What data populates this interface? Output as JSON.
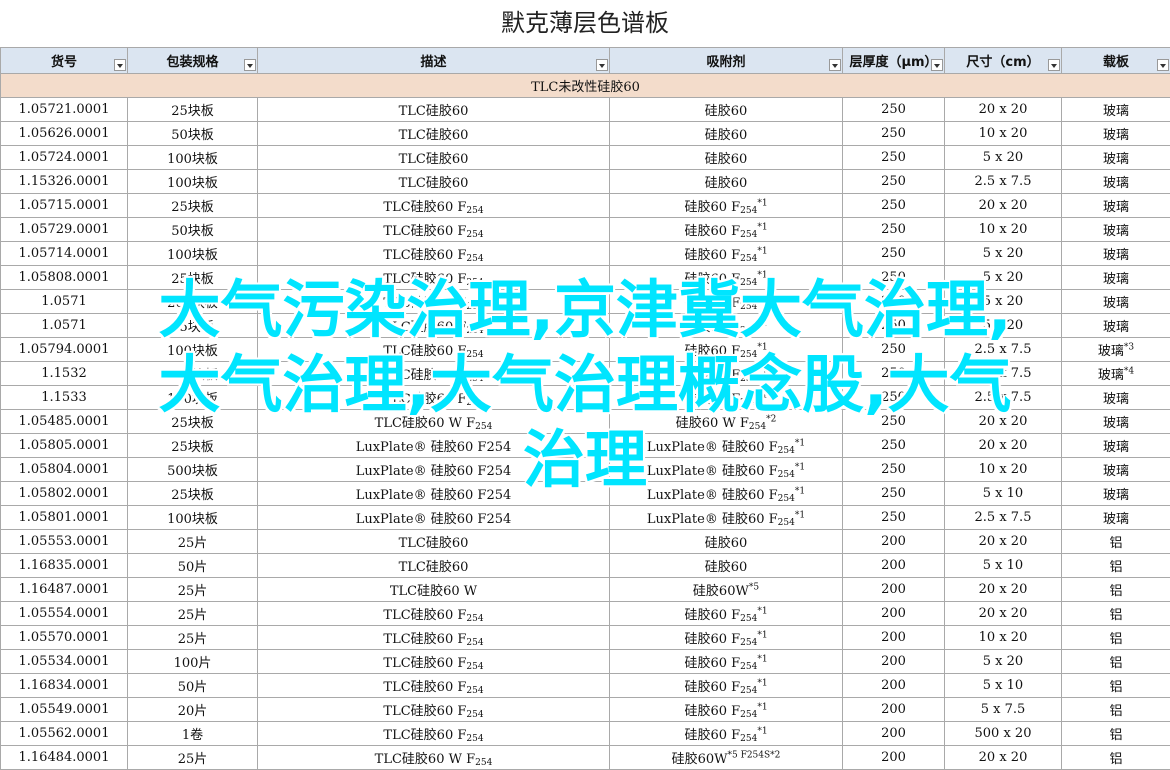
{
  "title": "默克薄层色谱板",
  "headers": [
    "货号",
    "包装规格",
    "描述",
    "吸附剂",
    "层厚度（μm）",
    "尺寸（cm）",
    "载板"
  ],
  "group_label": "TLC未改性硅胶60",
  "rows": [
    {
      "id": "1.05721.0001",
      "pack": "25块板",
      "desc": "TLC硅胶60",
      "desc_sub": "",
      "adsorb": "硅胶60",
      "adsorb_sub": "",
      "adsorb_sup": "",
      "thick": "250",
      "size": "20 x 20",
      "carrier": "玻璃",
      "carrier_sup": ""
    },
    {
      "id": "1.05626.0001",
      "pack": "50块板",
      "desc": "TLC硅胶60",
      "desc_sub": "",
      "adsorb": "硅胶60",
      "adsorb_sub": "",
      "adsorb_sup": "",
      "thick": "250",
      "size": "10 x 20",
      "carrier": "玻璃",
      "carrier_sup": ""
    },
    {
      "id": "1.05724.0001",
      "pack": "100块板",
      "desc": "TLC硅胶60",
      "desc_sub": "",
      "adsorb": "硅胶60",
      "adsorb_sub": "",
      "adsorb_sup": "",
      "thick": "250",
      "size": "5 x 20",
      "carrier": "玻璃",
      "carrier_sup": ""
    },
    {
      "id": "1.15326.0001",
      "pack": "100块板",
      "desc": "TLC硅胶60",
      "desc_sub": "",
      "adsorb": "硅胶60",
      "adsorb_sub": "",
      "adsorb_sup": "",
      "thick": "250",
      "size": "2.5 x 7.5",
      "carrier": "玻璃",
      "carrier_sup": ""
    },
    {
      "id": "1.05715.0001",
      "pack": "25块板",
      "desc": "TLC硅胶60 F",
      "desc_sub": "254",
      "adsorb": "硅胶60 F",
      "adsorb_sub": "254",
      "adsorb_sup": "*1",
      "thick": "250",
      "size": "20 x 20",
      "carrier": "玻璃",
      "carrier_sup": ""
    },
    {
      "id": "1.05729.0001",
      "pack": "50块板",
      "desc": "TLC硅胶60 F",
      "desc_sub": "254",
      "adsorb": "硅胶60 F",
      "adsorb_sub": "254",
      "adsorb_sup": "*1",
      "thick": "250",
      "size": "10 x 20",
      "carrier": "玻璃",
      "carrier_sup": ""
    },
    {
      "id": "1.05714.0001",
      "pack": "100块板",
      "desc": "TLC硅胶60 F",
      "desc_sub": "254",
      "adsorb": "硅胶60 F",
      "adsorb_sub": "254",
      "adsorb_sup": "*1",
      "thick": "250",
      "size": "5 x 20",
      "carrier": "玻璃",
      "carrier_sup": ""
    },
    {
      "id": "1.05808.0001",
      "pack": "25块板",
      "desc": "TLC硅胶60 F",
      "desc_sub": "254",
      "adsorb": "硅胶60 F",
      "adsorb_sub": "254",
      "adsorb_sup": "*1",
      "thick": "250",
      "size": "5 x 20",
      "carrier": "玻璃",
      "carrier_sup": ""
    },
    {
      "id": "1.0571",
      "pack": "200块板",
      "desc": "TLC硅胶60 F",
      "desc_sub": "254",
      "adsorb": "硅胶60 F",
      "adsorb_sub": "254",
      "adsorb_sup": "*1",
      "thick": "250",
      "size": "5 x 20",
      "carrier": "玻璃",
      "carrier_sup": ""
    },
    {
      "id": "1.0571",
      "pack": "25块板",
      "desc": "TLC硅胶60 F",
      "desc_sub": "254",
      "adsorb": "硅胶60 F",
      "adsorb_sub": "254",
      "adsorb_sup": "*1",
      "thick": "250",
      "size": "5 x 20",
      "carrier": "玻璃",
      "carrier_sup": ""
    },
    {
      "id": "1.05794.0001",
      "pack": "100块板",
      "desc": "TLC硅胶60 F",
      "desc_sub": "254",
      "adsorb": "硅胶60 F",
      "adsorb_sub": "254",
      "adsorb_sup": "*1",
      "thick": "250",
      "size": "2.5 x 7.5",
      "carrier": "玻璃",
      "carrier_sup": "*3"
    },
    {
      "id": "1.1532",
      "pack": "100块板",
      "desc": "TLC硅胶60 F",
      "desc_sub": "254",
      "adsorb": "硅胶60 F",
      "adsorb_sub": "254",
      "adsorb_sup": "*1",
      "thick": "250",
      "size": "2.5 x 7.5",
      "carrier": "玻璃",
      "carrier_sup": "*4"
    },
    {
      "id": "1.1533",
      "pack": "100块板",
      "desc": "TLC硅胶60 F",
      "desc_sub": "254",
      "adsorb": "硅胶60 F",
      "adsorb_sub": "254",
      "adsorb_sup": "*1",
      "thick": "250",
      "size": "2.5 x 7.5",
      "carrier": "玻璃",
      "carrier_sup": ""
    },
    {
      "id": "1.05485.0001",
      "pack": "25块板",
      "desc": "TLC硅胶60 W F",
      "desc_sub": "254",
      "adsorb": "硅胶60 W F",
      "adsorb_sub": "254",
      "adsorb_sup": "*2",
      "thick": "250",
      "size": "20 x 20",
      "carrier": "玻璃",
      "carrier_sup": ""
    },
    {
      "id": "1.05805.0001",
      "pack": "25块板",
      "desc": "LuxPlate® 硅胶60 F254",
      "desc_sub": "",
      "adsorb": "LuxPlate® 硅胶60 F",
      "adsorb_sub": "254",
      "adsorb_sup": "*1",
      "thick": "250",
      "size": "20 x 20",
      "carrier": "玻璃",
      "carrier_sup": ""
    },
    {
      "id": "1.05804.0001",
      "pack": "500块板",
      "desc": "LuxPlate® 硅胶60 F254",
      "desc_sub": "",
      "adsorb": "LuxPlate® 硅胶60 F",
      "adsorb_sub": "254",
      "adsorb_sup": "*1",
      "thick": "250",
      "size": "10 x 20",
      "carrier": "玻璃",
      "carrier_sup": ""
    },
    {
      "id": "1.05802.0001",
      "pack": "25块板",
      "desc": "LuxPlate® 硅胶60 F254",
      "desc_sub": "",
      "adsorb": "LuxPlate® 硅胶60 F",
      "adsorb_sub": "254",
      "adsorb_sup": "*1",
      "thick": "250",
      "size": "5 x 10",
      "carrier": "玻璃",
      "carrier_sup": ""
    },
    {
      "id": "1.05801.0001",
      "pack": "100块板",
      "desc": "LuxPlate® 硅胶60 F254",
      "desc_sub": "",
      "adsorb": "LuxPlate® 硅胶60 F",
      "adsorb_sub": "254",
      "adsorb_sup": "*1",
      "thick": "250",
      "size": "2.5 x 7.5",
      "carrier": "玻璃",
      "carrier_sup": ""
    },
    {
      "id": "1.05553.0001",
      "pack": "25片",
      "desc": "TLC硅胶60",
      "desc_sub": "",
      "adsorb": "硅胶60",
      "adsorb_sub": "",
      "adsorb_sup": "",
      "thick": "200",
      "size": "20 x 20",
      "carrier": "铝",
      "carrier_sup": ""
    },
    {
      "id": "1.16835.0001",
      "pack": "50片",
      "desc": "TLC硅胶60",
      "desc_sub": "",
      "adsorb": "硅胶60",
      "adsorb_sub": "",
      "adsorb_sup": "",
      "thick": "200",
      "size": "5 x 10",
      "carrier": "铝",
      "carrier_sup": ""
    },
    {
      "id": "1.16487.0001",
      "pack": "25片",
      "desc": "TLC硅胶60 W",
      "desc_sub": "",
      "adsorb": "硅胶60W",
      "adsorb_sub": "",
      "adsorb_sup": "*5",
      "thick": "200",
      "size": "20 x 20",
      "carrier": "铝",
      "carrier_sup": ""
    },
    {
      "id": "1.05554.0001",
      "pack": "25片",
      "desc": "TLC硅胶60 F",
      "desc_sub": "254",
      "adsorb": "硅胶60 F",
      "adsorb_sub": "254",
      "adsorb_sup": "*1",
      "thick": "200",
      "size": "20 x 20",
      "carrier": "铝",
      "carrier_sup": ""
    },
    {
      "id": "1.05570.0001",
      "pack": "25片",
      "desc": "TLC硅胶60 F",
      "desc_sub": "254",
      "adsorb": "硅胶60 F",
      "adsorb_sub": "254",
      "adsorb_sup": "*1",
      "thick": "200",
      "size": "10 x 20",
      "carrier": "铝",
      "carrier_sup": ""
    },
    {
      "id": "1.05534.0001",
      "pack": "100片",
      "desc": "TLC硅胶60 F",
      "desc_sub": "254",
      "adsorb": "硅胶60 F",
      "adsorb_sub": "254",
      "adsorb_sup": "*1",
      "thick": "200",
      "size": "5 x 20",
      "carrier": "铝",
      "carrier_sup": ""
    },
    {
      "id": "1.16834.0001",
      "pack": "50片",
      "desc": "TLC硅胶60 F",
      "desc_sub": "254",
      "adsorb": "硅胶60 F",
      "adsorb_sub": "254",
      "adsorb_sup": "*1",
      "thick": "200",
      "size": "5 x 10",
      "carrier": "铝",
      "carrier_sup": ""
    },
    {
      "id": "1.05549.0001",
      "pack": "20片",
      "desc": "TLC硅胶60 F",
      "desc_sub": "254",
      "adsorb": "硅胶60 F",
      "adsorb_sub": "254",
      "adsorb_sup": "*1",
      "thick": "200",
      "size": "5 x 7.5",
      "carrier": "铝",
      "carrier_sup": ""
    },
    {
      "id": "1.05562.0001",
      "pack": "1卷",
      "desc": "TLC硅胶60 F",
      "desc_sub": "254",
      "adsorb": "硅胶60 F",
      "adsorb_sub": "254",
      "adsorb_sup": "*1",
      "thick": "200",
      "size": "500 x 20",
      "carrier": "铝",
      "carrier_sup": ""
    },
    {
      "id": "1.16484.0001",
      "pack": "25片",
      "desc": "TLC硅胶60 W F",
      "desc_sub": "254",
      "adsorb": "硅胶60W",
      "adsorb_sub": "",
      "adsorb_sup": "*5 F254S*2",
      "thick": "200",
      "size": "20 x 20",
      "carrier": "铝",
      "carrier_sup": ""
    }
  ],
  "overlay_lines": [
    "大气污染治理,京津冀大气治理,",
    "大气治理,大气治理概念股,大气",
    "治理"
  ]
}
